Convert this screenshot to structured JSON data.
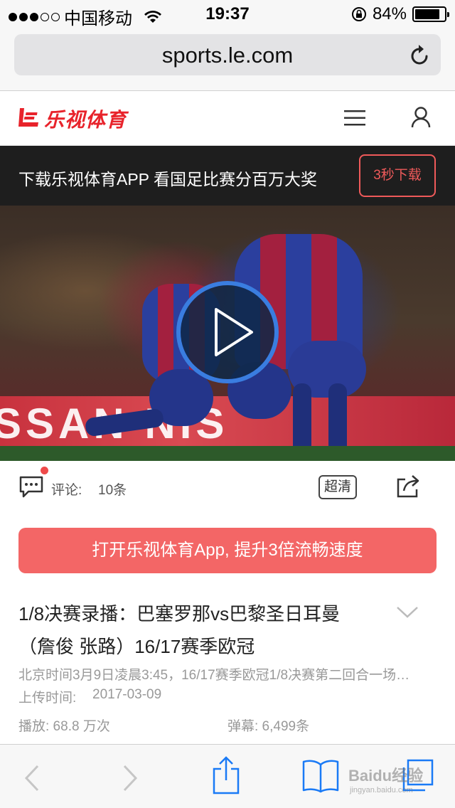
{
  "status_bar": {
    "carrier": "中国移动",
    "time": "19:37",
    "battery_percent_label": "84%",
    "battery_level": 0.84
  },
  "browser": {
    "url": "sports.le.com"
  },
  "site": {
    "logo_text": "乐视体育"
  },
  "banner": {
    "text": "下载乐视体育APP 看国足比赛分百万大奖",
    "button": "3秒下载"
  },
  "video": {
    "ad_board_text": "SSAN  NIS"
  },
  "info": {
    "comment_label": "评论:",
    "comment_count": "10条",
    "quality_button": "超清"
  },
  "open_app_button": "打开乐视体育App, 提升3倍流畅速度",
  "article": {
    "title": "1/8决赛录播：巴塞罗那vs巴黎圣日耳曼（詹俊 张路）16/17赛季欧冠",
    "description": "北京时间3月9日凌晨3:45，16/17赛季欧冠1/8决赛第二回合一场…",
    "upload_label": "上传时间:",
    "upload_date": "2017-03-09",
    "plays": "播放: 68.8 万次",
    "danmu": "弹幕: 6,499条"
  },
  "watermark": {
    "text": "Baidu经验",
    "sub": "jingyan.baidu.com"
  }
}
